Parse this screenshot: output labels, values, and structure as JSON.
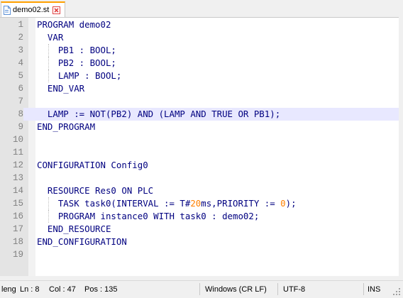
{
  "tab": {
    "file_name": "demo02.st",
    "file_icon": "file-icon",
    "close_icon": "close-icon"
  },
  "editor": {
    "current_line": 8,
    "lines": [
      {
        "n": "1",
        "code": "PROGRAM demo02"
      },
      {
        "n": "2",
        "code": "  VAR"
      },
      {
        "n": "3",
        "code": "    PB1 : BOOL;"
      },
      {
        "n": "4",
        "code": "    PB2 : BOOL;"
      },
      {
        "n": "5",
        "code": "    LAMP : BOOL;"
      },
      {
        "n": "6",
        "code": "  END_VAR"
      },
      {
        "n": "7",
        "code": ""
      },
      {
        "n": "8",
        "code": "  LAMP := NOT(PB2) AND (LAMP AND TRUE OR PB1);"
      },
      {
        "n": "9",
        "code": "END_PROGRAM"
      },
      {
        "n": "10",
        "code": ""
      },
      {
        "n": "11",
        "code": ""
      },
      {
        "n": "12",
        "code": "CONFIGURATION Config0"
      },
      {
        "n": "13",
        "code": ""
      },
      {
        "n": "14",
        "code": "  RESOURCE Res0 ON PLC"
      },
      {
        "n": "15",
        "code": "    TASK task0(INTERVAL := T#20ms,PRIORITY := 0);"
      },
      {
        "n": "16",
        "code": "    PROGRAM instance0 WITH task0 : demo02;"
      },
      {
        "n": "17",
        "code": "  END_RESOURCE"
      },
      {
        "n": "18",
        "code": "END_CONFIGURATION"
      },
      {
        "n": "19",
        "code": ""
      }
    ]
  },
  "statusbar": {
    "length": "leng",
    "line": "Ln : 8",
    "col": "Col : 47",
    "pos": "Pos : 135",
    "eol": "Windows (CR LF)",
    "encoding": "UTF-8",
    "mode": "INS"
  },
  "colors": {
    "text": "#000080",
    "number": "#ff8000",
    "current_line": "#e8e8ff",
    "tab_accent": "#ffa000",
    "close_icon": "#e04343"
  }
}
